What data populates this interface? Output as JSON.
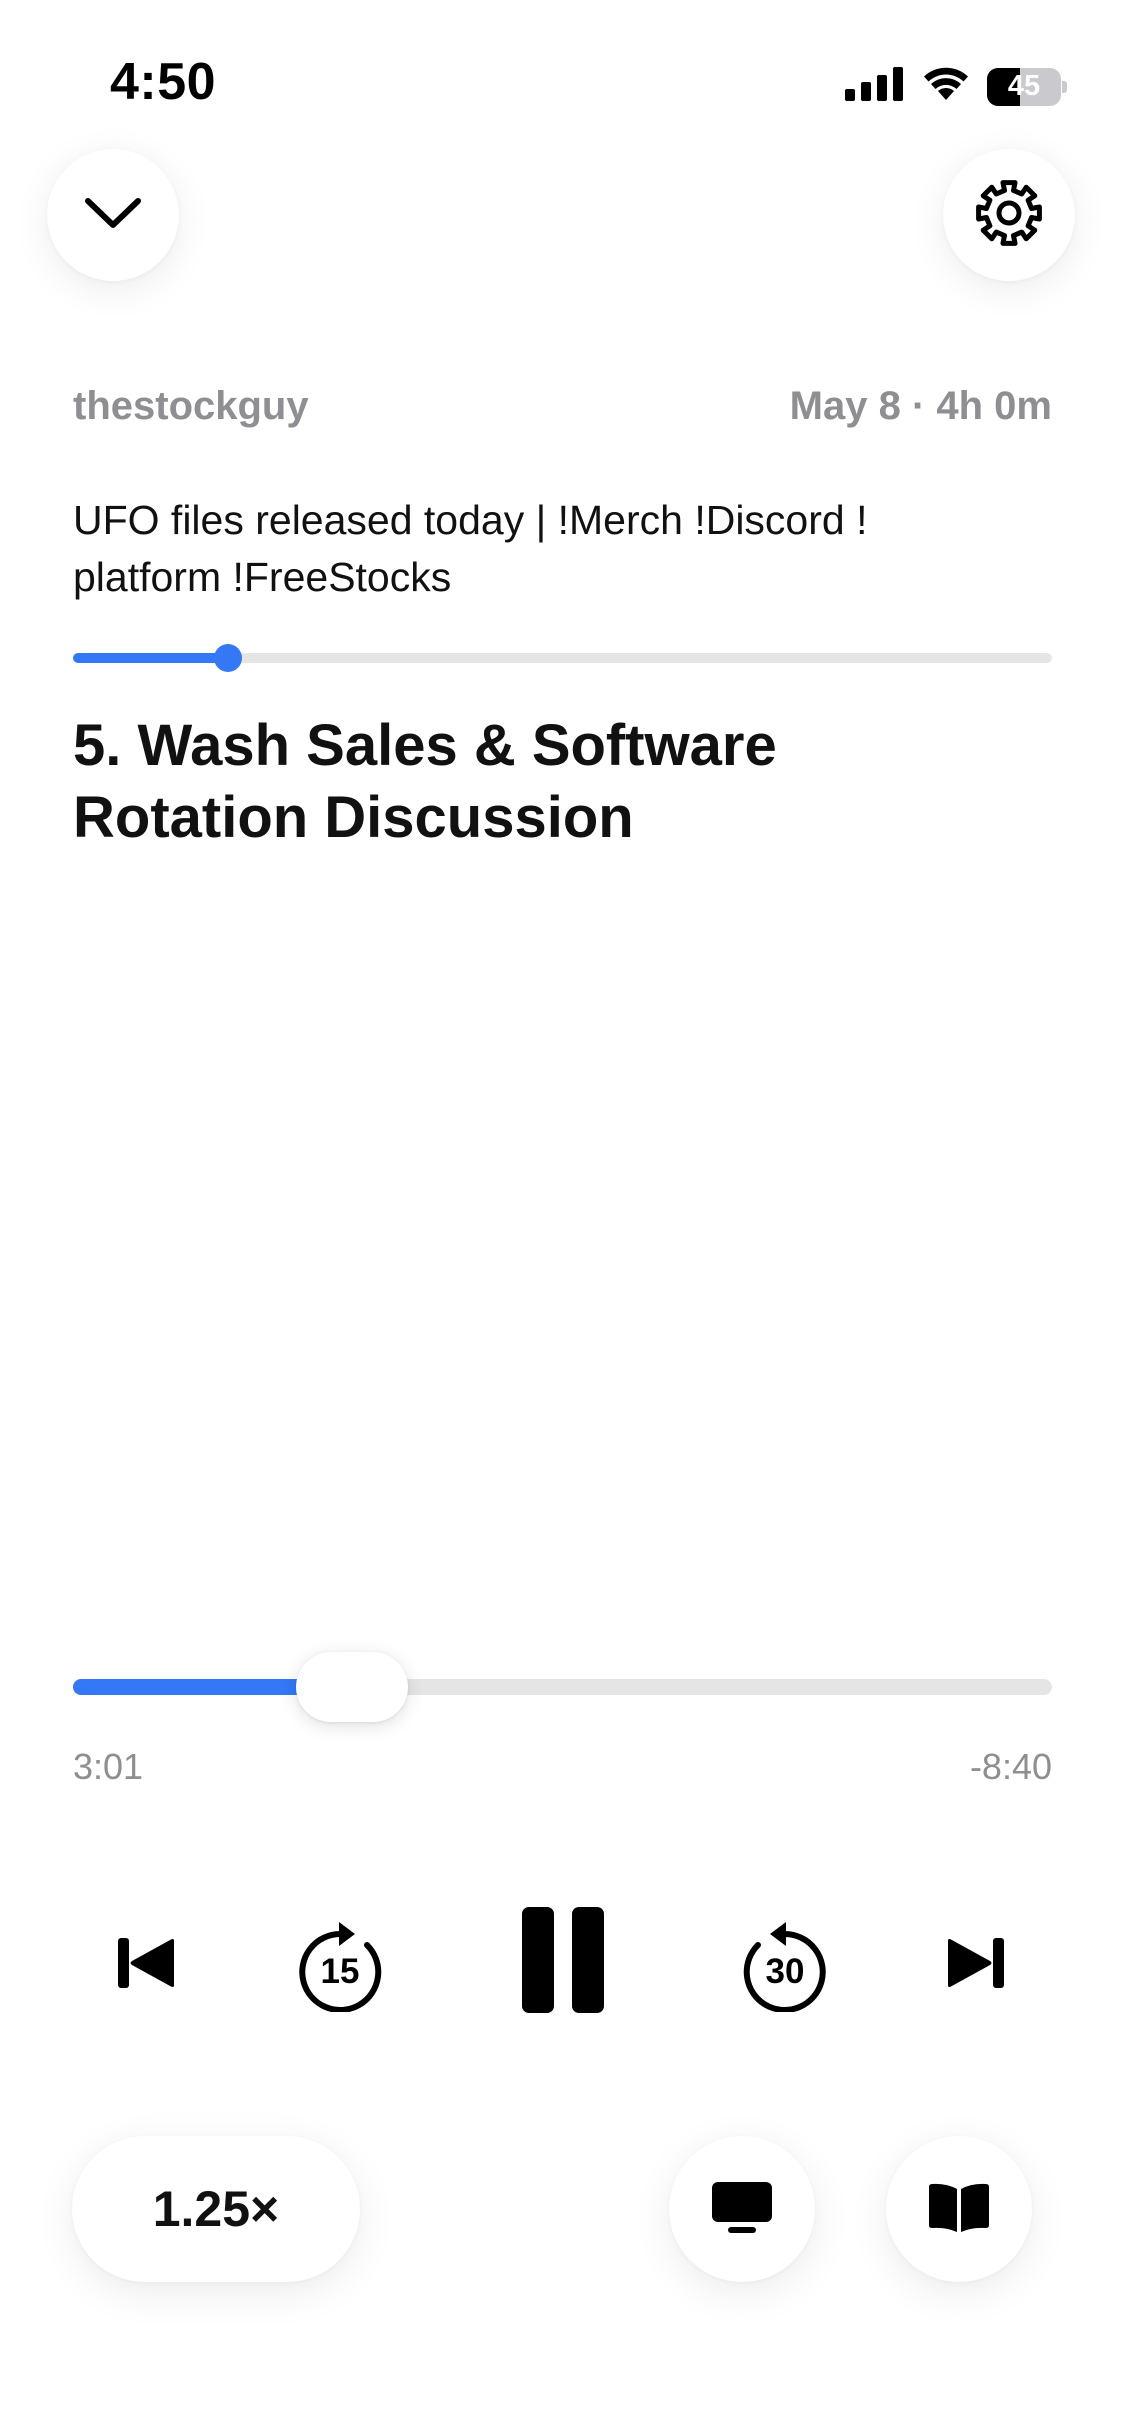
{
  "status_bar": {
    "time": "4:50",
    "battery_level": "45",
    "battery_fraction": 0.45
  },
  "header": {
    "collapse_icon": "chevron-down-icon",
    "settings_icon": "gear-icon"
  },
  "episode": {
    "channel": "thestockguy",
    "date_duration": "May 8 · 4h 0m",
    "title": "UFO files released today  | !Merch !Discord ! platform !FreeStocks",
    "overall_progress": 0.158
  },
  "chapter": {
    "title": "5. Wash Sales & Software Rotation Discussion",
    "progress": 0.285
  },
  "scrubber": {
    "elapsed": "3:01",
    "remaining": "-8:40"
  },
  "controls": {
    "previous_icon": "skip-back-icon",
    "rewind_icon": "rewind-15-icon",
    "rewind_label": "15",
    "pause_icon": "pause-icon",
    "forward_icon": "forward-30-icon",
    "forward_label": "30",
    "next_icon": "skip-forward-icon"
  },
  "bottom_bar": {
    "speed": "1.25×",
    "video_icon": "tv-icon",
    "chapters_icon": "book-icon"
  },
  "colors": {
    "accent": "#3478f6",
    "secondary_text": "#8e8e93",
    "track": "#e5e5e5"
  }
}
